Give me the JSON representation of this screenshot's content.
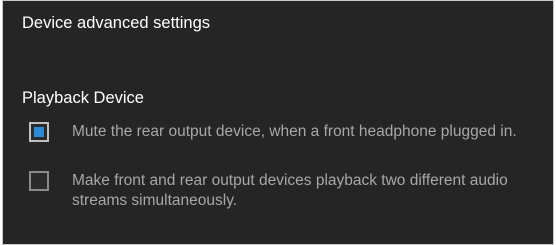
{
  "panel": {
    "title": "Device advanced settings"
  },
  "playback": {
    "heading": "Playback Device",
    "options": [
      {
        "label": "Mute the rear output device, when a front headphone plugged in.",
        "checked": true
      },
      {
        "label": "Make front and rear output devices playback two different audio streams simultaneously.",
        "checked": false
      }
    ]
  },
  "colors": {
    "background": "#252525",
    "accent": "#2a8ad6",
    "text_primary": "#ffffff",
    "text_secondary": "#a7a7a7"
  }
}
